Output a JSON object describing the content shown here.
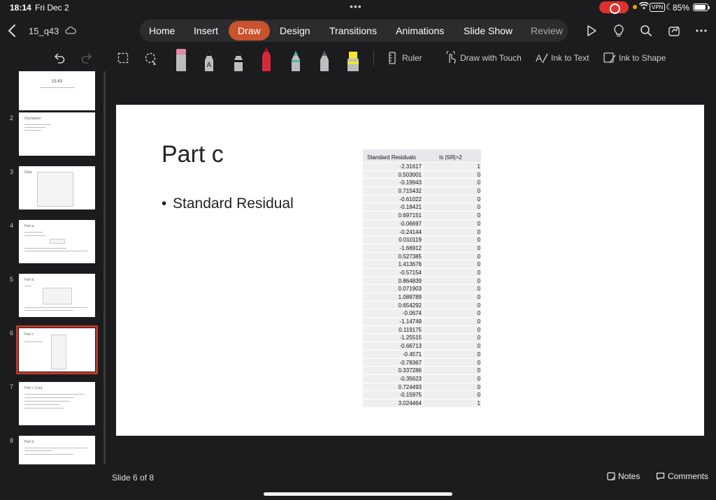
{
  "status_bar": {
    "time": "18:14",
    "date": "Fri Dec 2",
    "vpn": "VPN",
    "battery": "85%"
  },
  "header": {
    "document_title": "15_q43",
    "tabs": [
      {
        "label": "Home"
      },
      {
        "label": "Insert"
      },
      {
        "label": "Draw"
      },
      {
        "label": "Design"
      },
      {
        "label": "Transitions"
      },
      {
        "label": "Animations"
      },
      {
        "label": "Slide Show"
      },
      {
        "label": "Review"
      }
    ],
    "active_tab": "Draw"
  },
  "toolbar": {
    "ruler": "Ruler",
    "draw_with_touch": "Draw with Touch",
    "ink_to_text": "Ink to Text",
    "ink_to_shape": "Ink to Shape",
    "pen_colors": {
      "eraser": "#e68aa6",
      "pen_red": "#d62a3a",
      "pen_teal": "#4fb6b0",
      "highlighter": "#f5e52f"
    }
  },
  "sidebar": {
    "slides": [
      {
        "number": "",
        "title": "15.43"
      },
      {
        "number": "2",
        "title": "Disclaimer"
      },
      {
        "number": "3",
        "title": "Data"
      },
      {
        "number": "4",
        "title": "Part a"
      },
      {
        "number": "5",
        "title": "Part b"
      },
      {
        "number": "6",
        "title": "Part c"
      },
      {
        "number": "7",
        "title": "Part c Cont."
      },
      {
        "number": "8",
        "title": "Part d"
      }
    ],
    "selected_index": 5
  },
  "slide": {
    "title": "Part c",
    "bullet": "Standard Residual",
    "table": {
      "headers": [
        "Standard Residuals",
        "Is |SR|>2"
      ],
      "rows": [
        [
          "-2.31617",
          "1"
        ],
        [
          "0.503001",
          "0"
        ],
        [
          "-0.19943",
          "0"
        ],
        [
          "0.715432",
          "0"
        ],
        [
          "-0.61022",
          "0"
        ],
        [
          "-0.18421",
          "0"
        ],
        [
          "0.697151",
          "0"
        ],
        [
          "-0.06697",
          "0"
        ],
        [
          "-0.24144",
          "0"
        ],
        [
          "0.010119",
          "0"
        ],
        [
          "-1.66912",
          "0"
        ],
        [
          "0.527385",
          "0"
        ],
        [
          "1.413676",
          "0"
        ],
        [
          "-0.57154",
          "0"
        ],
        [
          "0.864839",
          "0"
        ],
        [
          "0.071903",
          "0"
        ],
        [
          "1.089789",
          "0"
        ],
        [
          "0.654292",
          "0"
        ],
        [
          "-0.0674",
          "0"
        ],
        [
          "-1.14749",
          "0"
        ],
        [
          "0.119175",
          "0"
        ],
        [
          "-1.25515",
          "0"
        ],
        [
          "-0.66713",
          "0"
        ],
        [
          "-0.4571",
          "0"
        ],
        [
          "-0.78367",
          "0"
        ],
        [
          "0.337286",
          "0"
        ],
        [
          "-0.35623",
          "0"
        ],
        [
          "0.724493",
          "0"
        ],
        [
          "-0.15975",
          "0"
        ],
        [
          "3.024464",
          "1"
        ]
      ]
    }
  },
  "footer": {
    "slide_counter": "Slide 6 of 8",
    "notes": "Notes",
    "comments": "Comments"
  },
  "theme": {
    "accent": "#c9532d",
    "selection": "#c0392b",
    "background": "#1c1c1e"
  }
}
